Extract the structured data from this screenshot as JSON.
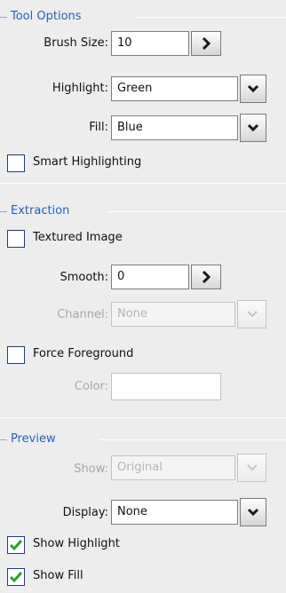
{
  "tool_options": {
    "title": "Tool Options",
    "brush_size": {
      "label": "Brush Size:",
      "value": "10",
      "button_icon": "arrow-right-icon"
    },
    "highlight": {
      "label": "Highlight:",
      "value": "Green",
      "button_icon": "chevron-down-icon"
    },
    "fill": {
      "label": "Fill:",
      "value": "Blue",
      "button_icon": "chevron-down-icon"
    },
    "smart_highlighting": {
      "label": "Smart Highlighting",
      "checked": false
    }
  },
  "extraction": {
    "title": "Extraction",
    "textured_image": {
      "label": "Textured Image",
      "checked": false
    },
    "smooth": {
      "label": "Smooth:",
      "value": "0",
      "button_icon": "arrow-right-icon"
    },
    "channel": {
      "label": "Channel:",
      "value": "None",
      "disabled": true
    },
    "force_foreground": {
      "label": "Force Foreground",
      "checked": false
    },
    "color": {
      "label": "Color:",
      "value": "",
      "disabled": true
    }
  },
  "preview": {
    "title": "Preview",
    "show": {
      "label": "Show:",
      "value": "Original",
      "disabled": true
    },
    "display": {
      "label": "Display:",
      "value": "None"
    },
    "show_highlight": {
      "label": "Show Highlight",
      "checked": true
    },
    "show_fill": {
      "label": "Show Fill",
      "checked": true
    }
  },
  "colors": {
    "panel_bg": "#ededed",
    "group_title": "#2a5fb0",
    "checkbox_border": "#1e3f73",
    "checkmark": "#2f9b2f",
    "disabled_text": "#a6a6a6"
  }
}
